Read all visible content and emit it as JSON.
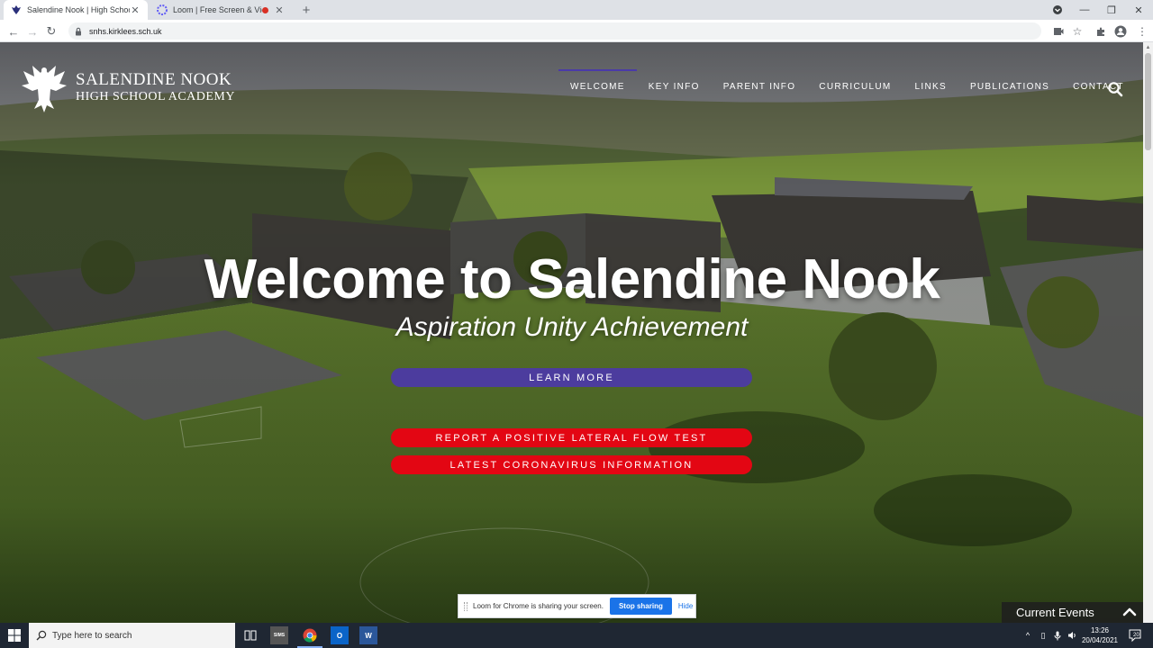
{
  "browser": {
    "tabs": [
      {
        "title": "Salendine Nook | High School Ac",
        "active": true
      },
      {
        "title": "Loom | Free Screen & Video",
        "active": false,
        "recording": true
      }
    ],
    "new_tab_label": "+",
    "url": "snhs.kirklees.sch.uk",
    "window_controls": {
      "minimize": "—",
      "maximize": "❐",
      "close": "✕"
    }
  },
  "site": {
    "logo": {
      "line1": "SALENDINE NOOK",
      "line2": "HIGH SCHOOL ACADEMY"
    },
    "nav": [
      {
        "label": "WELCOME",
        "active": true
      },
      {
        "label": "KEY INFO"
      },
      {
        "label": "PARENT INFO"
      },
      {
        "label": "CURRICULUM"
      },
      {
        "label": "LINKS"
      },
      {
        "label": "PUBLICATIONS"
      },
      {
        "label": "CONTACT"
      }
    ],
    "hero": {
      "title": "Welcome to Salendine Nook",
      "subtitle": "Aspiration Unity Achievement"
    },
    "buttons": {
      "learn_more": "LEARN MORE",
      "report_lft": "REPORT A POSITIVE LATERAL FLOW TEST",
      "coronavirus": "LATEST CORONAVIRUS INFORMATION"
    },
    "current_events": "Current Events",
    "colors": {
      "purple": "#4c3c9e",
      "red": "#e30613"
    }
  },
  "loom": {
    "message": "Loom for Chrome is sharing your screen.",
    "stop": "Stop sharing",
    "hide": "Hide"
  },
  "taskbar": {
    "search_placeholder": "Type here to search",
    "apps": [
      "task-view",
      "sims",
      "chrome",
      "outlook",
      "word"
    ],
    "sims_label": "SIMS",
    "outlook_label": "O",
    "word_label": "W",
    "time": "13:26",
    "date": "20/04/2021",
    "notification_count": "20"
  }
}
